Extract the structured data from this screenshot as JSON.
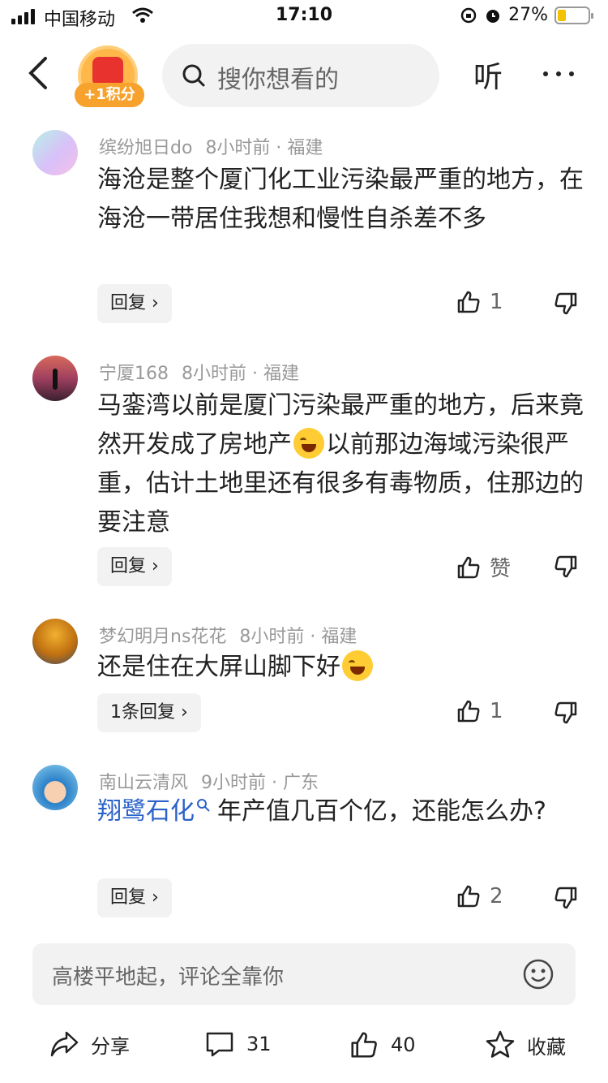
{
  "status_bar": {
    "carrier": "中国移动",
    "time": "17:10",
    "battery": "27%"
  },
  "nav": {
    "badge": "+1积分",
    "search_placeholder": "搜你想看的",
    "listen_label": "听"
  },
  "comments": [
    {
      "author": "缤纷旭日do",
      "time": "8小时前",
      "location": "福建",
      "text": "海沧是整个厦门化工业污染最严重的地方，在海沧一带居住我想和慢性自杀差不多",
      "reply_label": "回复",
      "likes": "1"
    },
    {
      "author": "宁厦168",
      "time": "8小时前",
      "location": "福建",
      "text_part1": "马銮湾以前是厦门污染最严重的地方，后来竟然开发成了房地产",
      "text_part2": "以前那边海域污染很严重，估计土地里还有很多有毒物质，住那边的要注意",
      "reply_label": "回复",
      "likes": "赞"
    },
    {
      "author": "梦幻明月ns花花",
      "time": "8小时前",
      "location": "福建",
      "text": "还是住在大屏山脚下好",
      "reply_label": "1条回复",
      "likes": "1"
    },
    {
      "author": "南山云清风",
      "time": "9小时前",
      "location": "广东",
      "link_text": "翔鹭石化",
      "text": "年产值几百个亿，还能怎么办?",
      "reply_label": "回复",
      "likes": "2"
    }
  ],
  "input": {
    "placeholder": "高楼平地起，评论全靠你"
  },
  "actions": {
    "share": "分享",
    "comments_count": "31",
    "likes_count": "40",
    "favorite": "收藏"
  },
  "colors": {
    "link": "#2a62c9",
    "badge": "#f7a22c",
    "battery": "#f2c200"
  }
}
